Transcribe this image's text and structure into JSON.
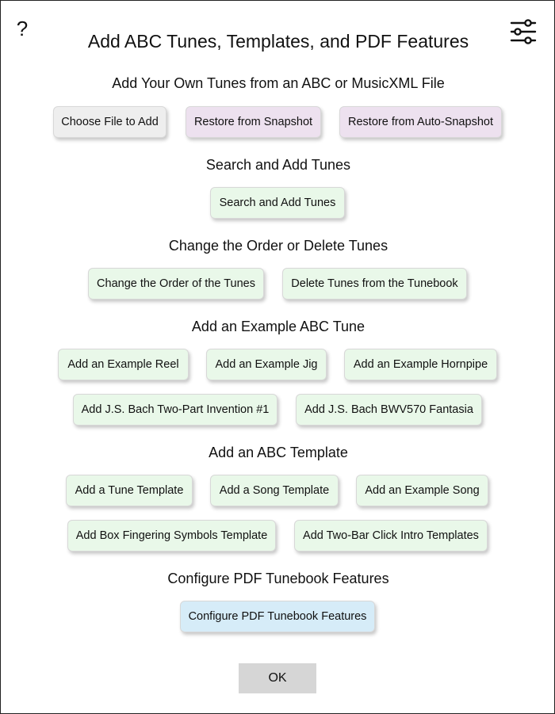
{
  "dialog": {
    "help_label": "?",
    "settings_icon": "sliders-icon",
    "title": "Add ABC Tunes, Templates, and PDF Features"
  },
  "sections": {
    "own_files": {
      "heading": "Add Your Own Tunes from an ABC or MusicXML File",
      "choose_file": "Choose File to Add",
      "restore_snapshot": "Restore from Snapshot",
      "restore_auto": "Restore from Auto-Snapshot"
    },
    "search": {
      "heading": "Search and Add Tunes",
      "search_button": "Search and Add Tunes"
    },
    "order": {
      "heading": "Change the Order or Delete Tunes",
      "change_order": "Change the Order of the Tunes",
      "delete_tunes": "Delete Tunes from the Tunebook"
    },
    "examples": {
      "heading": "Add an Example ABC Tune",
      "reel": "Add an Example Reel",
      "jig": "Add an Example Jig",
      "hornpipe": "Add an Example Hornpipe",
      "bach_invention": "Add J.S. Bach Two-Part Invention #1",
      "bach_fantasia": "Add J.S. Bach BWV570 Fantasia"
    },
    "templates": {
      "heading": "Add an ABC Template",
      "tune_template": "Add a Tune Template",
      "song_template": "Add a Song Template",
      "example_song": "Add an Example Song",
      "box_fingering": "Add Box Fingering Symbols Template",
      "click_intro": "Add Two-Bar Click Intro Templates"
    },
    "pdf": {
      "heading": "Configure PDF Tunebook Features",
      "configure": "Configure PDF Tunebook Features"
    }
  },
  "footer": {
    "ok_label": "OK"
  },
  "colors": {
    "gray_button": "#eeeeee",
    "snapshot_button": "#ede1ef",
    "green_button": "#e9f8e9",
    "blue_button": "#d6ecf8",
    "ok_button": "#d6d6d6"
  }
}
